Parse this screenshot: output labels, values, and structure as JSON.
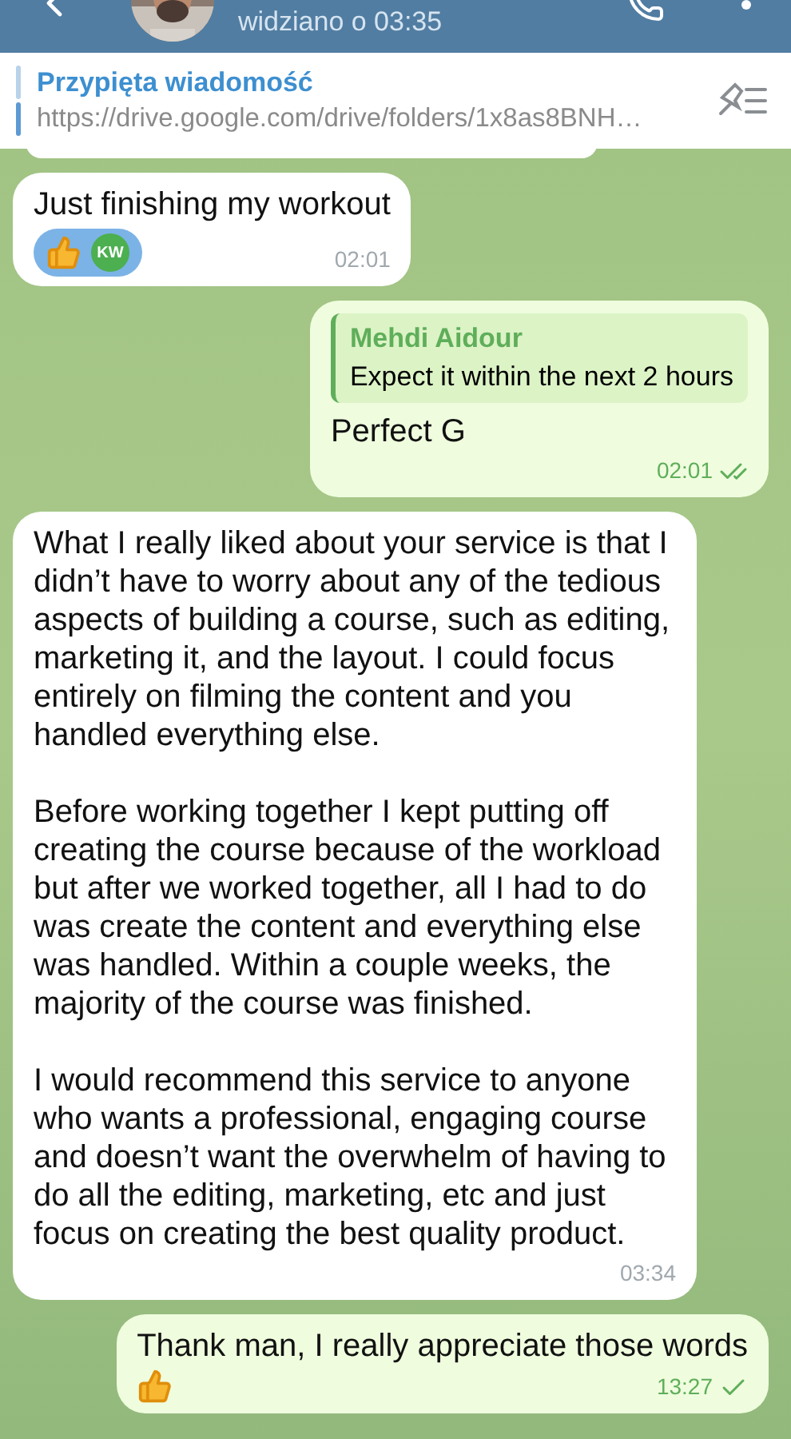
{
  "header": {
    "status": "widziano o 03:35"
  },
  "pinned": {
    "title": "Przypięta wiadomość",
    "text": "https://drive.google.com/drive/folders/1x8as8BNH…"
  },
  "messages": [
    {
      "kind": "partial",
      "outgoing": false
    },
    {
      "kind": "text",
      "outgoing": false,
      "paragraphs": [
        "Just finishing my workout"
      ],
      "reaction": {
        "avatar": "KW"
      },
      "time": "02:01"
    },
    {
      "kind": "reply",
      "outgoing": true,
      "reply_to": {
        "name": "Mehdi Aidour",
        "text": "Expect it within the next 2 hours"
      },
      "paragraphs": [
        "Perfect G"
      ],
      "time": "02:01",
      "read": true
    },
    {
      "kind": "text",
      "outgoing": false,
      "paragraphs": [
        "What I really liked about your service is that I didn’t have to worry about any of the tedious aspects of building a course, such as editing, marketing it, and the layout. I could focus entirely on filming the content and you handled everything else.",
        "Before working together I kept putting off creating the course because of the workload but after we worked together, all I had to do was create the content and everything else was handled. Within a couple weeks, the majority of the course was finished.",
        "I would recommend this service to anyone who wants a professional, engaging course and doesn’t want the overwhelm of having to do all the editing, marketing, etc and just focus on creating the best quality product."
      ],
      "time": "03:34"
    },
    {
      "kind": "text",
      "outgoing": true,
      "paragraphs": [
        "Thank man, I really appreciate those words"
      ],
      "thumbs": true,
      "time": "13:27",
      "read": false
    }
  ]
}
